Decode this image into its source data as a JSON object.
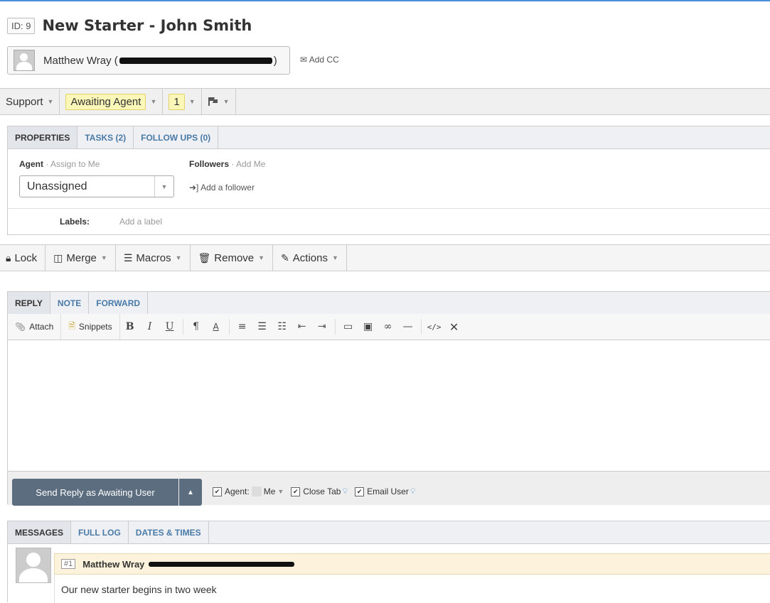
{
  "ticket": {
    "id_label": "ID: 9",
    "title": "New Starter - John Smith",
    "requester_name": "Matthew Wray (",
    "requester_close": ")",
    "add_cc": "Add CC"
  },
  "status_bar": {
    "department": "Support",
    "status": "Awaiting Agent",
    "urgency": "1"
  },
  "properties": {
    "tabs": [
      "PROPERTIES",
      "TASKS (2)",
      "FOLLOW UPS (0)"
    ],
    "agent_label": "Agent",
    "assign_to_me": "· Assign to Me",
    "agent_value": "Unassigned",
    "followers_label": "Followers",
    "add_me": "· Add Me",
    "add_follower": "Add a follower",
    "labels_label": "Labels:",
    "add_label": "Add a label"
  },
  "actions": {
    "lock": "Lock",
    "merge": "Merge",
    "macros": "Macros",
    "remove": "Remove",
    "actions": "Actions"
  },
  "reply": {
    "tabs": [
      "REPLY",
      "NOTE",
      "FORWARD"
    ],
    "attach": "Attach",
    "snippets": "Snippets",
    "send_label": "Send Reply as Awaiting User",
    "agent_opt": "Agent:",
    "agent_me": "Me",
    "close_tab": "Close Tab",
    "email_user": "Email User"
  },
  "messages": {
    "tabs": [
      "MESSAGES",
      "FULL LOG",
      "DATES & TIMES"
    ],
    "items": [
      {
        "num": "#1",
        "author": "Matthew Wray",
        "body": "Our new starter begins in two week"
      }
    ]
  },
  "colors": {
    "accent": "#4a90d9",
    "status_highlight": "#fbf7b8",
    "send_button": "#5c6d80",
    "message_header": "#fdf3dc"
  }
}
